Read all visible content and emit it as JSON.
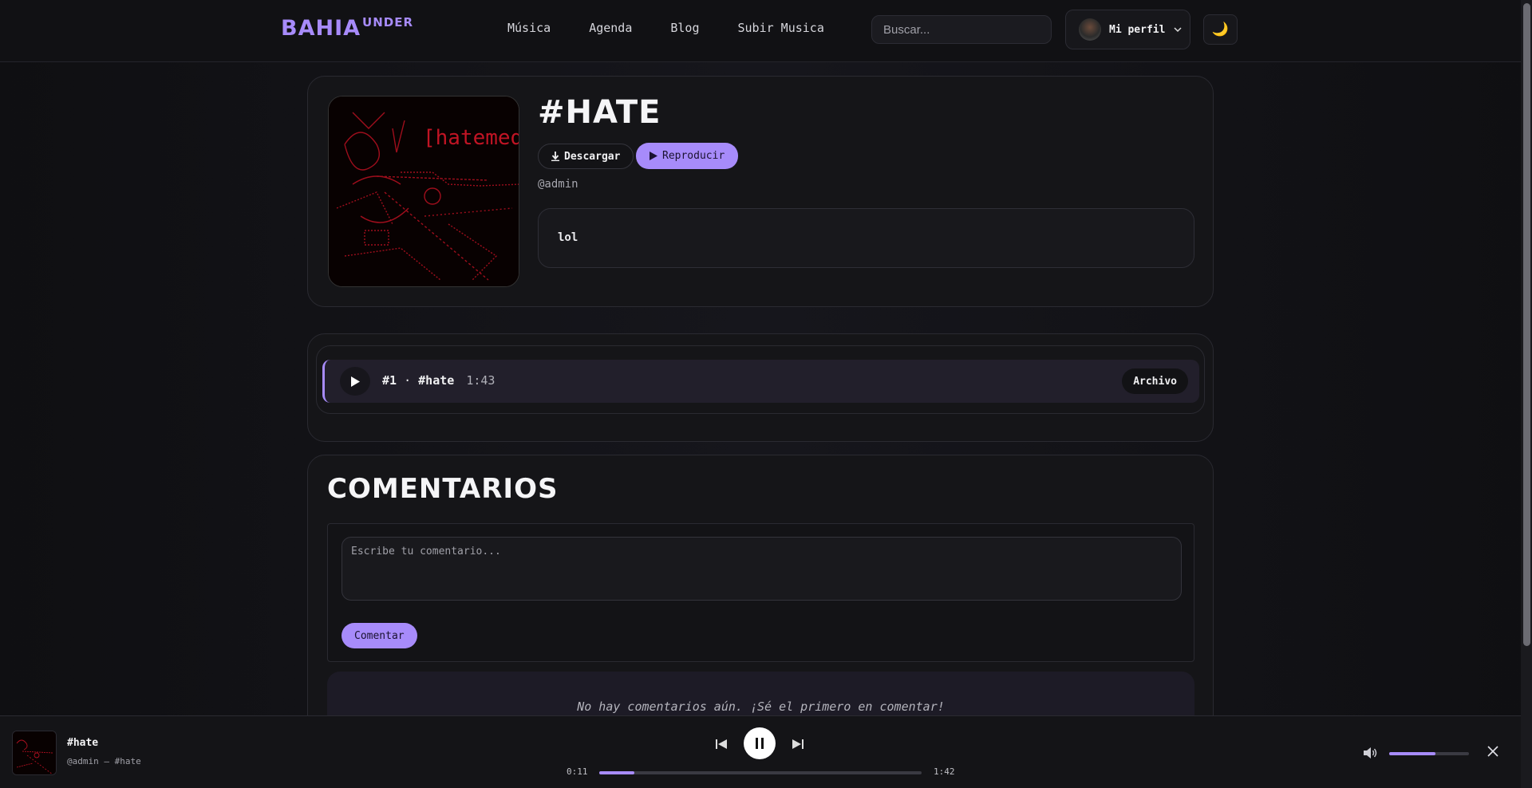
{
  "header": {
    "logo_main": "BAHIA",
    "logo_sup": "UNDER",
    "nav": [
      "Música",
      "Agenda",
      "Blog",
      "Subir Musica"
    ],
    "search_placeholder": "Buscar...",
    "profile_label": "Mi perfil",
    "theme_icon": "🌙"
  },
  "song": {
    "title": "#HATE",
    "download_label": "Descargar",
    "play_label": "Reproducir",
    "author": "@admin",
    "description": "lol",
    "cover_text": "[hatemed"
  },
  "tracks": [
    {
      "number": "#1",
      "separator": "·",
      "name": "#hate",
      "duration": "1:43",
      "file_label": "Archivo"
    }
  ],
  "comments": {
    "title": "COMENTARIOS",
    "placeholder": "Escribe tu comentario...",
    "submit_label": "Comentar",
    "empty_text": "No hay comentarios aún. ¡Sé el primero en comentar!"
  },
  "player": {
    "title": "#hate",
    "subtitle": "@admin — #hate",
    "current_time": "0:11",
    "total_time": "1:42",
    "progress": 0.11,
    "volume": 0.58
  },
  "colors": {
    "accent": "#a78bfa",
    "background": "#0f0f12",
    "card": "#151518"
  },
  "icons": [
    "download-icon",
    "play-icon",
    "pause-icon",
    "skip-back-icon",
    "skip-forward-icon",
    "volume-icon",
    "close-icon",
    "chevron-down-icon",
    "moon-icon"
  ]
}
